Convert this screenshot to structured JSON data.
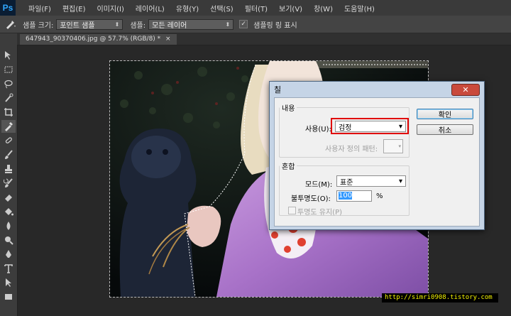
{
  "app": {
    "logo": "Ps"
  },
  "menu": [
    "파일(F)",
    "편집(E)",
    "이미지(I)",
    "레이어(L)",
    "유형(Y)",
    "선택(S)",
    "필터(T)",
    "보기(V)",
    "창(W)",
    "도움말(H)"
  ],
  "options_bar": {
    "sample_size_label": "샘플 크기:",
    "sample_size_value": "포인트 샘플",
    "sample_label": "샘플:",
    "sample_value": "모든 레이어",
    "show_ring_label": "샘플링 링 표시",
    "show_ring_checked": true
  },
  "document": {
    "tab_title": "647943_90370406.jpg @ 57.7% (RGB/8) *",
    "tab_close": "×"
  },
  "dialog": {
    "title": "칠",
    "close": "✕",
    "contents": {
      "legend": "내용",
      "use_label": "사용(U):",
      "use_value": "검정",
      "custom_pattern_label": "사용자 정의 패턴:"
    },
    "blending": {
      "legend": "혼합",
      "mode_label": "모드(M):",
      "mode_value": "표준",
      "opacity_label": "불투명도(O):",
      "opacity_value": "100",
      "opacity_unit": "%",
      "preserve_label": "투명도 유지(P)"
    },
    "buttons": {
      "ok": "확인",
      "cancel": "취소"
    }
  },
  "watermark": "http://simri0908.tistory.com",
  "colors": {
    "highlight": "#e00000",
    "selection": "#3399ff"
  }
}
